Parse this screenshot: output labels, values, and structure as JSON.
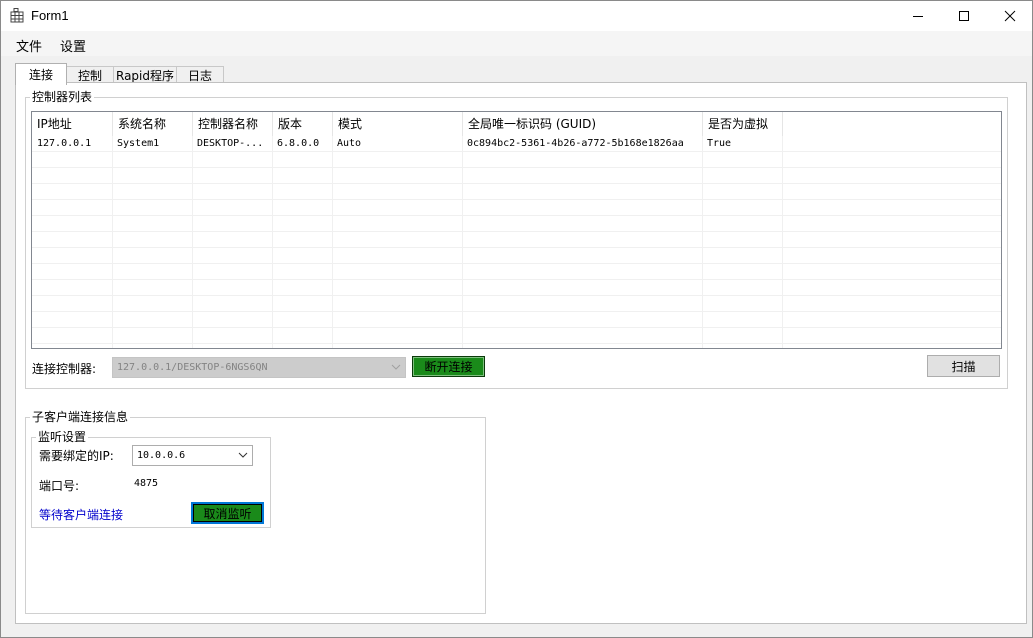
{
  "window": {
    "title": "Form1",
    "icon": "grid-app-icon"
  },
  "menu": [
    "文件",
    "设置"
  ],
  "tabs": [
    "连接",
    "控制",
    "Rapid程序",
    "日志"
  ],
  "controllers": {
    "group_title": "控制器列表",
    "columns": [
      "IP地址",
      "系统名称",
      "控制器名称",
      "版本",
      "模式",
      "全局唯一标识码 (GUID)",
      "是否为虚拟"
    ],
    "rows": [
      [
        "127.0.0.1",
        "System1",
        "DESKTOP-...",
        "6.8.0.0",
        "Auto",
        "0c894bc2-5361-4b26-a772-5b168e1826aa",
        "True"
      ]
    ],
    "connect_label": "连接控制器:",
    "connect_value": "127.0.0.1/DESKTOP-6NGS6QN",
    "disconnect_button": "断开连接",
    "scan_button": "扫描"
  },
  "client": {
    "group_title": "子客户端连接信息",
    "listen_title": "监听设置",
    "bind_ip_label": "需要绑定的IP:",
    "bind_ip_value": "10.0.0.6",
    "port_label": "端口号:",
    "port_value": "4875",
    "status_text": "等待客户端连接",
    "cancel_button": "取消监听"
  },
  "colors": {
    "accent_green": "#1a8a1a",
    "focus_blue": "#0078d7",
    "link_blue": "#0000cc"
  }
}
